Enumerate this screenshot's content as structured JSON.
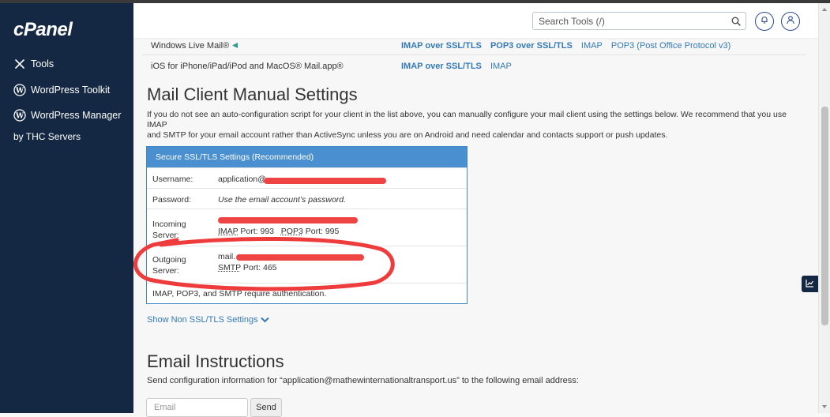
{
  "sidebar": {
    "logo": "cPanel",
    "items": [
      {
        "label": "Tools"
      },
      {
        "label": "WordPress Toolkit"
      },
      {
        "label": "WordPress Manager"
      }
    ],
    "sub_label": "by THC Servers"
  },
  "header": {
    "search_placeholder": "Search Tools (/)"
  },
  "clients": [
    {
      "name": "Windows Live Mail®",
      "links": [
        "IMAP over SSL/TLS",
        "POP3 over SSL/TLS",
        "IMAP",
        "POP3 (Post Office Protocol v3)"
      ]
    },
    {
      "name": "iOS for iPhone/iPad/iPod and MacOS® Mail.app®",
      "links": [
        "IMAP over SSL/TLS",
        "IMAP"
      ]
    }
  ],
  "manual": {
    "title": "Mail Client Manual Settings",
    "description_1": "If you do not see an auto-configuration script for your client in the list above, you can manually configure your mail client using the settings below. We recommend that you use IMAP",
    "description_2": "and SMTP for your email account rather than ActiveSync unless you are on Android and need calendar and contacts support or push updates.",
    "panel_title": "Secure SSL/TLS Settings (Recommended)",
    "username_label": "Username:",
    "username_value": "application@",
    "password_label": "Password:",
    "password_value": "Use the email account’s password.",
    "incoming_label_1": "Incoming",
    "incoming_label_2": "Server:",
    "incoming_ports_imap": "IMAP",
    "incoming_ports_imap_port": "Port: 993",
    "incoming_ports_pop3": "POP3",
    "incoming_ports_pop3_port": "Port: 995",
    "outgoing_label_1": "Outgoing",
    "outgoing_label_2": "Server:",
    "outgoing_value": "mail.",
    "outgoing_smtp": "SMTP",
    "outgoing_port": "Port: 465",
    "auth_note": "IMAP, POP3, and SMTP require authentication.",
    "show_non_ssl": "Show Non SSL/TLS Settings"
  },
  "instructions": {
    "title": "Email Instructions",
    "text": "Send configuration information for “application@mathewinternationaltransport.us” to the following email address:",
    "email_placeholder": "Email",
    "send_label": "Send"
  },
  "colors": {
    "sidebar": "#142843",
    "link": "#337ab7",
    "panel_header": "#4a90d0",
    "redaction": "#ee4444"
  }
}
